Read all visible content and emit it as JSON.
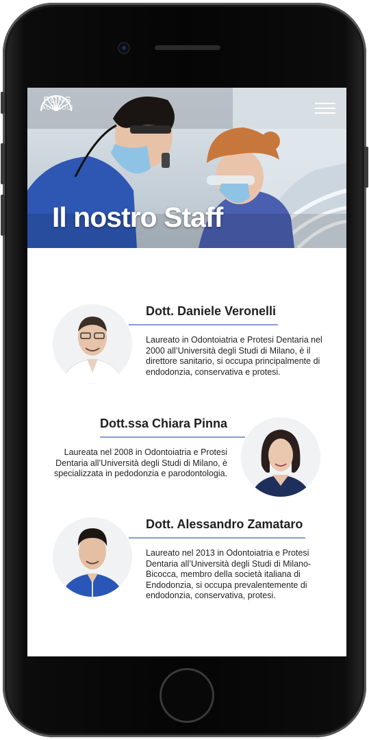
{
  "site": {
    "logo_text": "PONS",
    "logo_subtext": "AUREOLI"
  },
  "hero": {
    "title": "Il nostro Staff"
  },
  "staff": [
    {
      "name": "Dott. Daniele Veronelli",
      "bio": "Laureato in Odontoiatria e Protesi Dentaria nel 2000 all’Università degli Studi di Milano, è il direttore sanitario, si occupa principalmente di endodonzia, conservativa e protesi."
    },
    {
      "name": "Dott.ssa Chiara Pinna",
      "bio": "Laureata nel 2008 in Odontoiatria e Protesi Dentaria all’Università degli Studi di Milano, è specializzata in pedodonzia e parodontologia."
    },
    {
      "name": "Dott. Alessandro Zamataro",
      "bio": "Laureato nel 2013 in Odontoiatria e Protesi Dentaria all’Università degli Studi di Milano-Bicocca, membro della società italiana di Endodonzia, si occupa prevalentemente di endodonzia, conservativa, protesi."
    }
  ],
  "icons": {
    "logo": "sunburst-logo-icon",
    "menu": "hamburger-menu-icon"
  },
  "colors": {
    "accent_rule": "#8a9acb",
    "text": "#222222"
  }
}
